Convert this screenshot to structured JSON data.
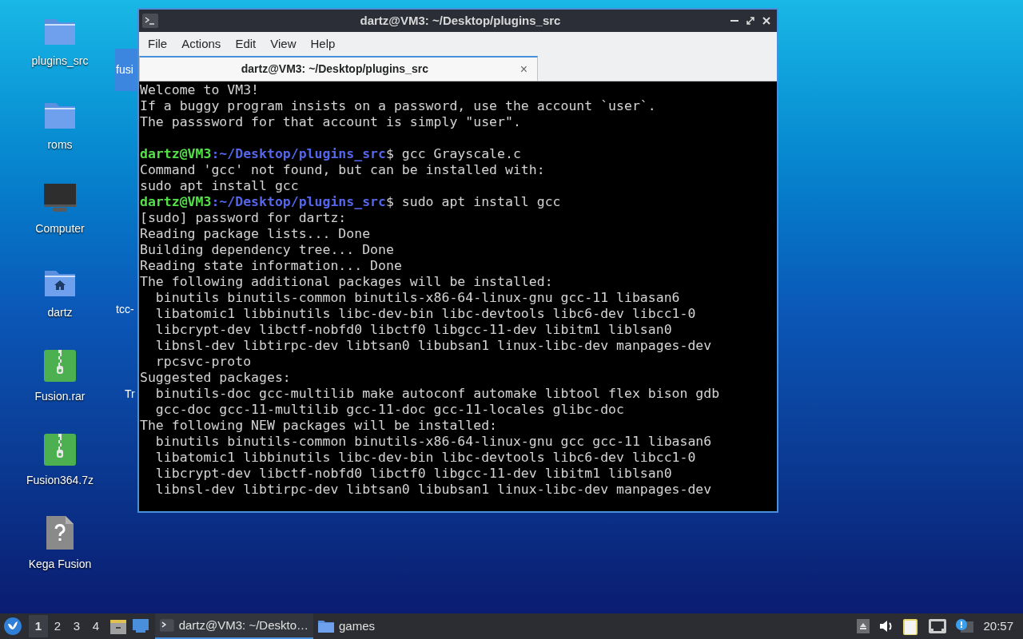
{
  "desktop": {
    "icons": [
      {
        "kind": "folder",
        "label": "plugins_src"
      },
      {
        "kind": "folder",
        "label": "roms"
      },
      {
        "kind": "computer",
        "label": "Computer"
      },
      {
        "kind": "home",
        "label": "dartz"
      },
      {
        "kind": "archive",
        "label": "Fusion.rar"
      },
      {
        "kind": "archive",
        "label": "Fusion364.7z"
      },
      {
        "kind": "unknown",
        "label": "Kega Fusion"
      }
    ],
    "hidden_labels": [
      {
        "label": "fusi",
        "selected": true
      },
      {
        "label": "tcc-",
        "selected": false
      },
      {
        "label": "Tr",
        "selected": false
      }
    ]
  },
  "window": {
    "title": "dartz@VM3: ~/Desktop/plugins_src",
    "menu": [
      "File",
      "Actions",
      "Edit",
      "View",
      "Help"
    ],
    "tabs": [
      {
        "label": "dartz@VM3: ~/Desktop/plugins_src",
        "close": "×",
        "selected": true
      }
    ],
    "lines": [
      {
        "kind": "text",
        "text": "Welcome to VM3!"
      },
      {
        "kind": "text",
        "text": "If a buggy program insists on a password, use the account `user`."
      },
      {
        "kind": "text",
        "text": "The passsword for that account is simply \"user\"."
      },
      {
        "kind": "blank"
      },
      {
        "kind": "prompt",
        "user": "dartz@VM3",
        "path": ":~/Desktop/plugins_src",
        "command": "$ gcc Grayscale.c"
      },
      {
        "kind": "text",
        "text": "Command 'gcc' not found, but can be installed with:"
      },
      {
        "kind": "text",
        "text": "sudo apt install gcc"
      },
      {
        "kind": "prompt",
        "user": "dartz@VM3",
        "path": ":~/Desktop/plugins_src",
        "command": "$ sudo apt install gcc"
      },
      {
        "kind": "text",
        "text": "[sudo] password for dartz:"
      },
      {
        "kind": "text",
        "text": "Reading package lists... Done"
      },
      {
        "kind": "text",
        "text": "Building dependency tree... Done"
      },
      {
        "kind": "text",
        "text": "Reading state information... Done"
      },
      {
        "kind": "text",
        "text": "The following additional packages will be installed:"
      },
      {
        "kind": "text",
        "text": "  binutils binutils-common binutils-x86-64-linux-gnu gcc-11 libasan6"
      },
      {
        "kind": "text",
        "text": "  libatomic1 libbinutils libc-dev-bin libc-devtools libc6-dev libcc1-0"
      },
      {
        "kind": "text",
        "text": "  libcrypt-dev libctf-nobfd0 libctf0 libgcc-11-dev libitm1 liblsan0"
      },
      {
        "kind": "text",
        "text": "  libnsl-dev libtirpc-dev libtsan0 libubsan1 linux-libc-dev manpages-dev"
      },
      {
        "kind": "text",
        "text": "  rpcsvc-proto"
      },
      {
        "kind": "text",
        "text": "Suggested packages:"
      },
      {
        "kind": "text",
        "text": "  binutils-doc gcc-multilib make autoconf automake libtool flex bison gdb"
      },
      {
        "kind": "text",
        "text": "  gcc-doc gcc-11-multilib gcc-11-doc gcc-11-locales glibc-doc"
      },
      {
        "kind": "text",
        "text": "The following NEW packages will be installed:"
      },
      {
        "kind": "text",
        "text": "  binutils binutils-common binutils-x86-64-linux-gnu gcc gcc-11 libasan6"
      },
      {
        "kind": "text",
        "text": "  libatomic1 libbinutils libc-dev-bin libc-devtools libc6-dev libcc1-0"
      },
      {
        "kind": "text",
        "text": "  libcrypt-dev libctf-nobfd0 libctf0 libgcc-11-dev libitm1 liblsan0"
      },
      {
        "kind": "text",
        "text": "  libnsl-dev libtirpc-dev libtsan0 libubsan1 linux-libc-dev manpages-dev"
      }
    ]
  },
  "taskbar": {
    "workspaces": [
      {
        "label": "1",
        "selected": true
      },
      {
        "label": "2",
        "selected": false
      },
      {
        "label": "3",
        "selected": false
      },
      {
        "label": "4",
        "selected": false
      }
    ],
    "tasks": [
      {
        "kind": "terminal",
        "label": "dartz@VM3: ~/Deskto…",
        "selected": true
      },
      {
        "kind": "folder",
        "label": "games",
        "selected": false
      }
    ],
    "clock": "20:57"
  }
}
